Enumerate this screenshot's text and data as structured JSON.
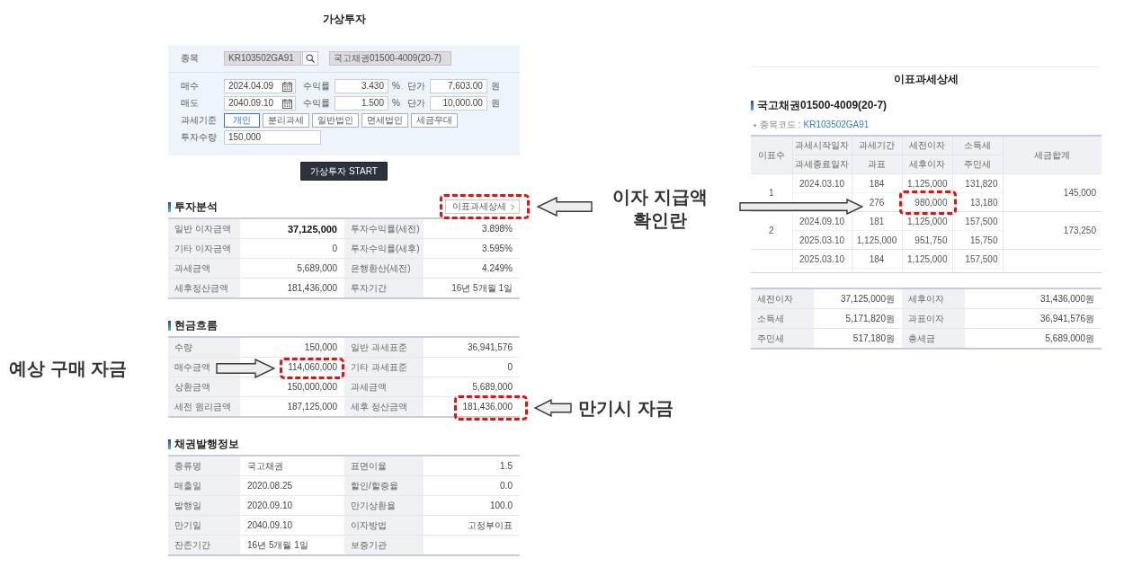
{
  "left": {
    "title": "가상투자",
    "form": {
      "security": {
        "label": "종목",
        "code": "KR103502GA91",
        "name": "국고채권01500-4009(20-7)"
      },
      "trades": [
        {
          "label": "매수",
          "date": "2024.04.09",
          "yield_label": "수익률",
          "yield": "3.430",
          "yield_unit": "%",
          "price_label": "단가",
          "price": "7,603.00",
          "price_unit": "원"
        },
        {
          "label": "매도",
          "date": "2040.09.10",
          "yield_label": "수익률",
          "yield": "1.500",
          "yield_unit": "%",
          "price_label": "단가",
          "price": "10,000.00",
          "price_unit": "원"
        }
      ],
      "tax_basis": {
        "label": "과세기준",
        "options": [
          {
            "label": "개인",
            "selected": true
          },
          {
            "label": "분리과세",
            "selected": false
          },
          {
            "label": "일반법인",
            "selected": false
          },
          {
            "label": "면세법인",
            "selected": false
          },
          {
            "label": "세금우대",
            "selected": false
          }
        ]
      },
      "quantity": {
        "label": "투자수량",
        "value": "150,000"
      }
    },
    "start_button": "가상투자 START",
    "sections": [
      {
        "title": "투자분석",
        "kind": "figures",
        "link_button": "이표과세상세",
        "rows": [
          [
            {
              "label": "일반 이자금액",
              "value": "37,125,000",
              "bold": true
            },
            {
              "label": "투자수익률(세전)",
              "value": "3.898%",
              "bold": false
            }
          ],
          [
            {
              "label": "기타 이자금액",
              "value": "0",
              "bold": false
            },
            {
              "label": "투자수익률(세후)",
              "value": "3.595%",
              "bold": false
            }
          ],
          [
            {
              "label": "과세금액",
              "value": "5,689,000",
              "bold": false
            },
            {
              "label": "은행환산(세전)",
              "value": "4.249%",
              "bold": false
            }
          ],
          [
            {
              "label": "세후정산금액",
              "value": "181,436,000",
              "bold": false
            },
            {
              "label": "투자기간",
              "value": "16년 5개월 1일",
              "bold": false
            }
          ]
        ]
      },
      {
        "title": "현금흐름",
        "kind": "figures",
        "rows": [
          [
            {
              "label": "수량",
              "value": "150,000",
              "bold": false
            },
            {
              "label": "일반 과세표준",
              "value": "36,941,576",
              "bold": false
            }
          ],
          [
            {
              "label": "매수금액",
              "value": "114,060,000",
              "bold": false
            },
            {
              "label": "기타 과세표준",
              "value": "0",
              "bold": false
            }
          ],
          [
            {
              "label": "상환금액",
              "value": "150,000,000",
              "bold": false
            },
            {
              "label": "과세금액",
              "value": "5,689,000",
              "bold": false
            }
          ],
          [
            {
              "label": "세전 원리금액",
              "value": "187,125,000",
              "bold": false
            },
            {
              "label": "세후 정산금액",
              "value": "181,436,000",
              "bold": false
            }
          ]
        ]
      },
      {
        "title": "채권발행정보",
        "kind": "details",
        "rows": [
          [
            {
              "label": "종류명",
              "value": "국고채권",
              "bold": false
            },
            {
              "label": "표면이율",
              "value": "1.5",
              "bold": false
            }
          ],
          [
            {
              "label": "매출일",
              "value": "2020.08.25",
              "bold": false
            },
            {
              "label": "할인/할증율",
              "value": "0.0",
              "bold": false
            }
          ],
          [
            {
              "label": "발행일",
              "value": "2020.09.10",
              "bold": false
            },
            {
              "label": "만기상환율",
              "value": "100.0",
              "bold": false
            }
          ],
          [
            {
              "label": "만기일",
              "value": "2040.09.10",
              "bold": false
            },
            {
              "label": "이자방법",
              "value": "고정부이표",
              "bold": false
            }
          ],
          [
            {
              "label": "잔존기간",
              "value": "16년 5개월 1일",
              "bold": false
            },
            {
              "label": "보증기관"
            }
          ]
        ]
      }
    ]
  },
  "right": {
    "title": "이표과세상세",
    "bond_name": "국고채권01500-4009(20-7)",
    "code_label": "종목코드 :",
    "code": "KR103502GA91",
    "columns": {
      "index": "이표수",
      "top": [
        "과세시작일자",
        "과세기간",
        "세전이자",
        "소득세"
      ],
      "bottom": [
        "과세종료일자",
        "과표",
        "세후이자",
        "주민세"
      ],
      "total": "세금합계"
    },
    "coupons": [
      {
        "index": "1",
        "start": {
          "date": "2024.03.10",
          "days": "184",
          "pre_tax_interest": "1,125,000",
          "income_tax": "131,820"
        },
        "end": {
          "tax_base": "276",
          "after_tax_interest": "980,000",
          "resident_tax": "13,180"
        },
        "total": "145,000"
      },
      {
        "index": "2",
        "start": {
          "date": "2024.09.10",
          "days": "181",
          "pre_tax_interest": "1,125,000",
          "income_tax": "157,500"
        },
        "end": {
          "date": "2025.03.10",
          "tax_base": "1,125,000",
          "after_tax_interest": "951,750",
          "resident_tax": "15,750"
        },
        "total": "173,250"
      },
      {
        "start": {
          "date": "2025.03.10",
          "days": "184",
          "pre_tax_interest": "1,125,000",
          "income_tax": "157,500"
        }
      }
    ],
    "totals": [
      [
        {
          "label": "세전이자",
          "value": "37,125,000원"
        },
        {
          "label": "세후이자",
          "value": "31,436,000원"
        }
      ],
      [
        {
          "label": "소득세",
          "value": "5,171,820원"
        },
        {
          "label": "과표이자",
          "value": "36,941,576원"
        }
      ],
      [
        {
          "label": "주민세",
          "value": "517,180원"
        },
        {
          "label": "총세금",
          "value": "5,689,000원"
        }
      ]
    ]
  },
  "annotations": [
    "이자 지급액 확인란",
    "예상 구매 자금",
    "만기시 자금"
  ]
}
